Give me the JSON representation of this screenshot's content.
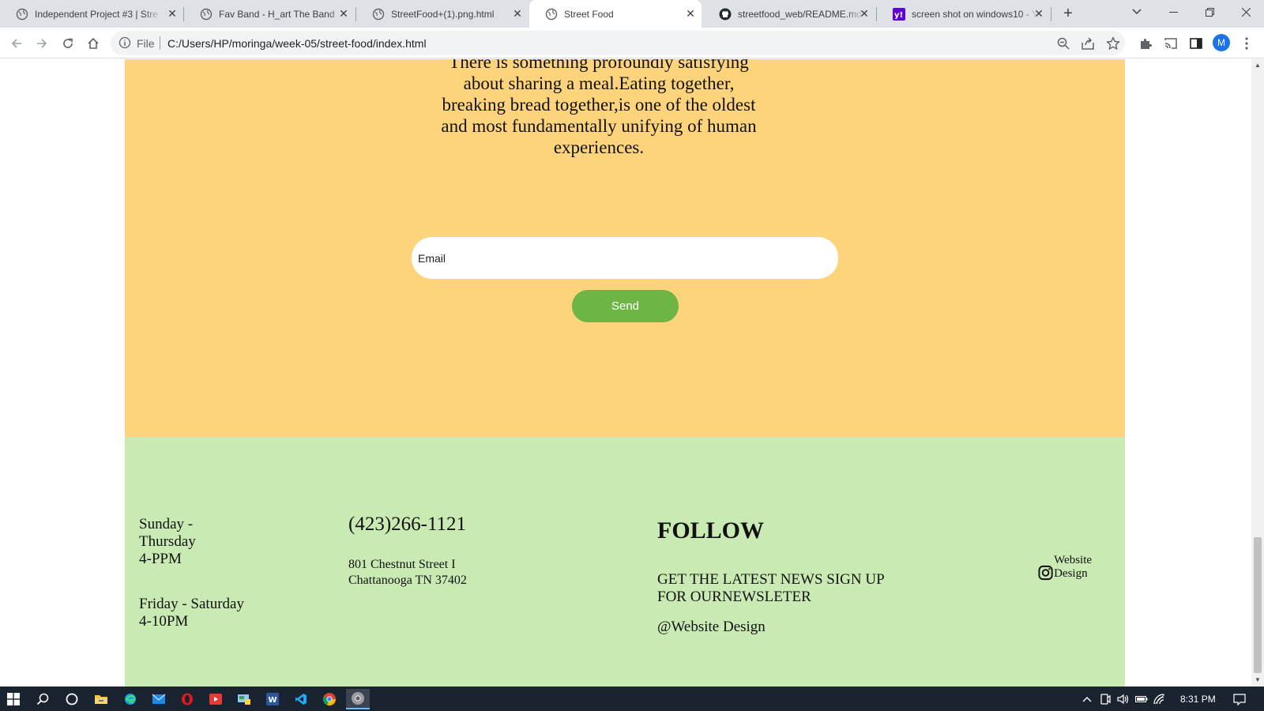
{
  "browser": {
    "tabs": [
      {
        "label": "Independent Project #3 | Stre",
        "favicon": "globe-icon"
      },
      {
        "label": "Fav Band - H_art The Band",
        "favicon": "globe-icon"
      },
      {
        "label": "StreetFood+(1).png.html",
        "favicon": "globe-icon"
      },
      {
        "label": "Street Food",
        "favicon": "globe-icon",
        "active": true
      },
      {
        "label": "streetfood_web/README.md",
        "favicon": "github-icon"
      },
      {
        "label": "screen shot on windows10 - Y",
        "favicon": "yahoo-icon"
      }
    ],
    "scheme_label": "File",
    "url": "C:/Users/HP/moringa/week-05/street-food/index.html",
    "profile_initial": "M"
  },
  "hero": {
    "quote": "There is something profoundly satisfying about sharing a meal.Eating together, breaking bread together,is one of the oldest and most fundamentally unifying of human experiences.",
    "email_placeholder": "Email",
    "send_label": "Send",
    "background": "#fdd47c",
    "button_color": "#6db645"
  },
  "footer": {
    "background": "#c9ebb3",
    "hours_weekday_days": "Sunday - Thursday",
    "hours_weekday_time": "4-PPM",
    "hours_weekend_days": "Friday - Saturday",
    "hours_weekend_time": "4-10PM",
    "phone": "(423)266-1121",
    "address_line1": "801 Chestnut Street I",
    "address_line2": "Chattanooga TN 37402",
    "follow_heading": "FOLLOW",
    "news_text": "GET THE LATEST NEWS SIGN UP FOR OURNEWSLETER",
    "handle": "@Website Design",
    "social_label": "Website Design",
    "social_icon": "instagram-icon"
  },
  "taskbar": {
    "time": "8:31 PM"
  }
}
